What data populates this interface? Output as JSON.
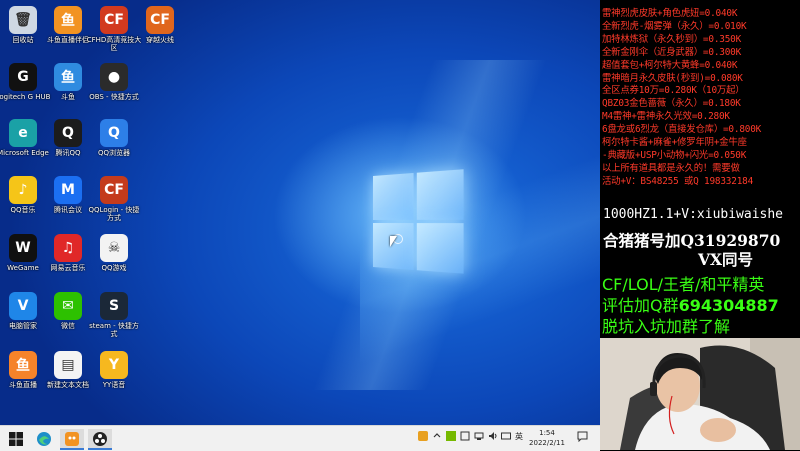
{
  "desktop": {
    "icons": [
      {
        "label": "回收站",
        "glyph": "🗑",
        "color": "#cfd8e3",
        "icon": "recycle-bin-icon"
      },
      {
        "label": "斗鱼直播伴侣",
        "glyph": "鱼",
        "color": "#f29322",
        "icon": "douyu-companion-icon"
      },
      {
        "label": "CFHD高清竞技大区",
        "glyph": "CF",
        "color": "#d23a1f",
        "icon": "cfhd-icon"
      },
      {
        "label": "穿越火线",
        "glyph": "CF",
        "color": "#e0661d",
        "icon": "crossfire-icon"
      },
      {
        "label": "Logitech G HUB",
        "glyph": "G",
        "color": "#111111",
        "icon": "logitech-ghub-icon"
      },
      {
        "label": "斗鱼",
        "glyph": "鱼",
        "color": "#2f8be0",
        "icon": "douyu-icon"
      },
      {
        "label": "OBS - 快捷方式",
        "glyph": "●",
        "color": "#2b2b2b",
        "icon": "obs-icon"
      },
      {
        "label": "Microsoft Edge",
        "glyph": "e",
        "color": "#1aa1a6",
        "icon": "edge-icon"
      },
      {
        "label": "腾讯QQ",
        "glyph": "Q",
        "color": "#1c1c1c",
        "icon": "qq-icon"
      },
      {
        "label": "QQ浏览器",
        "glyph": "Q",
        "color": "#2d7fe8",
        "icon": "qq-browser-icon"
      },
      {
        "label": "QQ音乐",
        "glyph": "♪",
        "color": "#f5c518",
        "icon": "qq-music-icon"
      },
      {
        "label": "腾讯会议",
        "glyph": "M",
        "color": "#1b6ff2",
        "icon": "tencent-meeting-icon"
      },
      {
        "label": "QQLogin - 快捷方式",
        "glyph": "CF",
        "color": "#c43b1c",
        "icon": "qqlogin-icon"
      },
      {
        "label": "WeGame",
        "glyph": "W",
        "color": "#101010",
        "icon": "wegame-icon"
      },
      {
        "label": "网易云音乐",
        "glyph": "♫",
        "color": "#e02828",
        "icon": "netease-music-icon"
      },
      {
        "label": "QQ游戏",
        "glyph": "☠",
        "color": "#f3f3f3",
        "icon": "qq-game-icon"
      },
      {
        "label": "电脑管家",
        "glyph": "V",
        "color": "#1f86e8",
        "icon": "pc-manager-icon"
      },
      {
        "label": "微信",
        "glyph": "✉",
        "color": "#2dc100",
        "icon": "wechat-icon"
      },
      {
        "label": "steam - 快捷方式",
        "glyph": "S",
        "color": "#1b2838",
        "icon": "steam-icon"
      },
      {
        "label": "斗鱼直播",
        "glyph": "鱼",
        "color": "#f5832a",
        "icon": "douyu-live-icon"
      },
      {
        "label": "新建文本文档",
        "glyph": "▤",
        "color": "#f4f4f4",
        "icon": "text-document-icon"
      },
      {
        "label": "YY语音",
        "glyph": "Y",
        "color": "#f6b81f",
        "icon": "yy-voice-icon"
      }
    ]
  },
  "taskbar": {
    "items": [
      {
        "icon": "start-windows-icon"
      },
      {
        "icon": "edge-icon"
      },
      {
        "icon": "douyu-companion-icon"
      },
      {
        "icon": "obs-icon"
      }
    ],
    "tray_lang": "英",
    "time": "1:54",
    "date": "2022/2/11"
  },
  "overlay": {
    "price_lines": [
      "雷神烈虎皮肤+角色虎妞=0.040K",
      "全新烈虎-烟雾弹（永久）=0.010K",
      "加特林炼狱（永久秒到）=0.350K",
      "全新金刚伞（近身武器）=0.300K",
      "超值套包+柯尔特大黄蜂=0.040K",
      "雷神暗月永久皮肤(秒到)=0.080K",
      "全区点券10万=0.280K（10万起）",
      "QBZ03金色蔷薇（永久）=0.180K",
      "M4雷神+雷神永久光效=0.280K",
      "6盘龙或6烈龙（直接发仓库）=0.800K",
      "柯尔特卡酱+麻雀+修罗年阴+金牛座",
      "-典藏版+USP小动物+闪光=0.050K",
      "以上所有道具都是永久的！需要做",
      "活动+V：BS48255  或Q 198332184"
    ],
    "contact_line": "1000HZ1.1+V:xiubiwaishe",
    "ad_line1": "合猪猪号加Q31929870",
    "ad_line2": "VX同号",
    "green_line1": "CF/LOL/王者/和平精英",
    "green_line2_prefix": "评估加Q群",
    "green_line2_number": "694304887",
    "green_line3": "脱坑入坑加群了解"
  },
  "colors": {
    "accent_red": "#ff3a2a",
    "accent_green": "#39ff14",
    "taskbar_bg": "#f1f1f1",
    "desktop_blue": "#0c47b8"
  }
}
